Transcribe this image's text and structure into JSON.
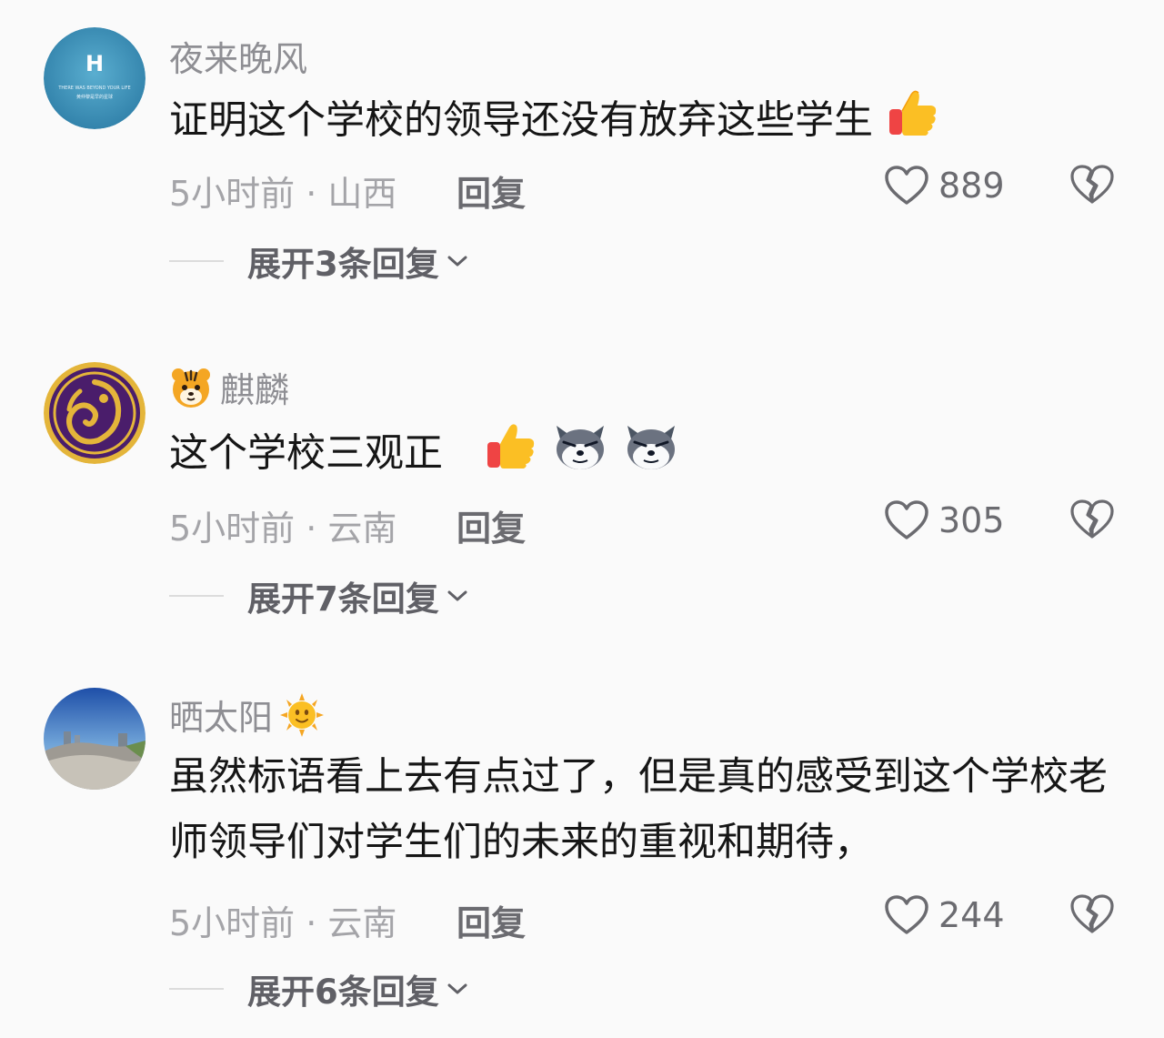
{
  "comments": [
    {
      "username": "夜来晚风",
      "text": "证明这个学校的领导还没有放弃这些学生",
      "time_location": "5小时前 · 山西",
      "reply_label": "回复",
      "likes": "889",
      "expand_label": "展开3条回复",
      "avatar_text": "H",
      "avatar_small_text": "THERE WAS BEYOND YOUR LIFE",
      "avatar_small_text_2": "黄仲黎是早的星球",
      "emojis": [
        "thumbs-up-icon"
      ]
    },
    {
      "username": "麒麟",
      "username_emoji": "tiger-face-icon",
      "text": "这个学校三观正",
      "time_location": "5小时前 · 云南",
      "reply_label": "回复",
      "likes": "305",
      "expand_label": "展开7条回复",
      "emojis": [
        "thumbs-up-icon",
        "husky-face-icon",
        "husky-face-icon"
      ]
    },
    {
      "username": "晒太阳",
      "username_emoji": "sun-face-icon",
      "text": "虽然标语看上去有点过了，但是真的感受到这个学校老师领导们对学生们的未来的重视和期待，",
      "time_location": "5小时前 · 云南",
      "reply_label": "回复",
      "likes": "244",
      "expand_label": "展开6条回复",
      "emojis": []
    }
  ],
  "colors": {
    "background": "#fafafa",
    "username": "#8e8e93",
    "body_text": "#161616",
    "meta_text": "#a4a4a8",
    "action_text": "#6b6b70"
  }
}
